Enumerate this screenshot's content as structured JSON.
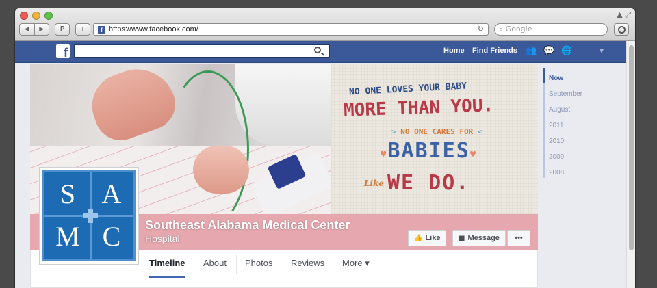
{
  "browser": {
    "url": "https://www.facebook.com/",
    "search_placeholder": "Google",
    "nav_back": "◀",
    "nav_forward": "▶",
    "reader_label": "P",
    "new_tab": "+",
    "reload_icon": "↻",
    "fav_letter": "f",
    "window_corner": "▲ ⤢"
  },
  "fb_header": {
    "logo": "f",
    "nav": [
      "Home",
      "Find Friends"
    ],
    "icons": [
      "friends-icon",
      "messages-icon",
      "globe-icon",
      "settings-icon"
    ],
    "icon_glyphs": [
      "👥",
      "💬",
      "🌐",
      "▾"
    ]
  },
  "cover_art": {
    "line1": "No one loves your baby",
    "line2": "More than you.",
    "line3_prefix": ">",
    "line3": "No one cares for",
    "line3_suffix": "<",
    "line4": "Babies",
    "heart": "♥",
    "line5_italic": "Like",
    "line5": "We do."
  },
  "page": {
    "name": "Southeast Alabama Medical Center",
    "category": "Hospital",
    "logo_letters": [
      "S",
      "A",
      "M",
      "C"
    ]
  },
  "actions": {
    "like": "Like",
    "like_icon": "👍",
    "message": "Message",
    "message_icon": "■",
    "more": "•••"
  },
  "tabs": [
    "Timeline",
    "About",
    "Photos",
    "Reviews",
    "More ▾"
  ],
  "timeline_years": [
    "Now",
    "September",
    "August",
    "2011",
    "2010",
    "2009",
    "2008"
  ],
  "colors": {
    "facebook_blue": "#3b5998",
    "cover_pink": "#e6a7ae",
    "logo_blue": "#1d6cb3"
  }
}
